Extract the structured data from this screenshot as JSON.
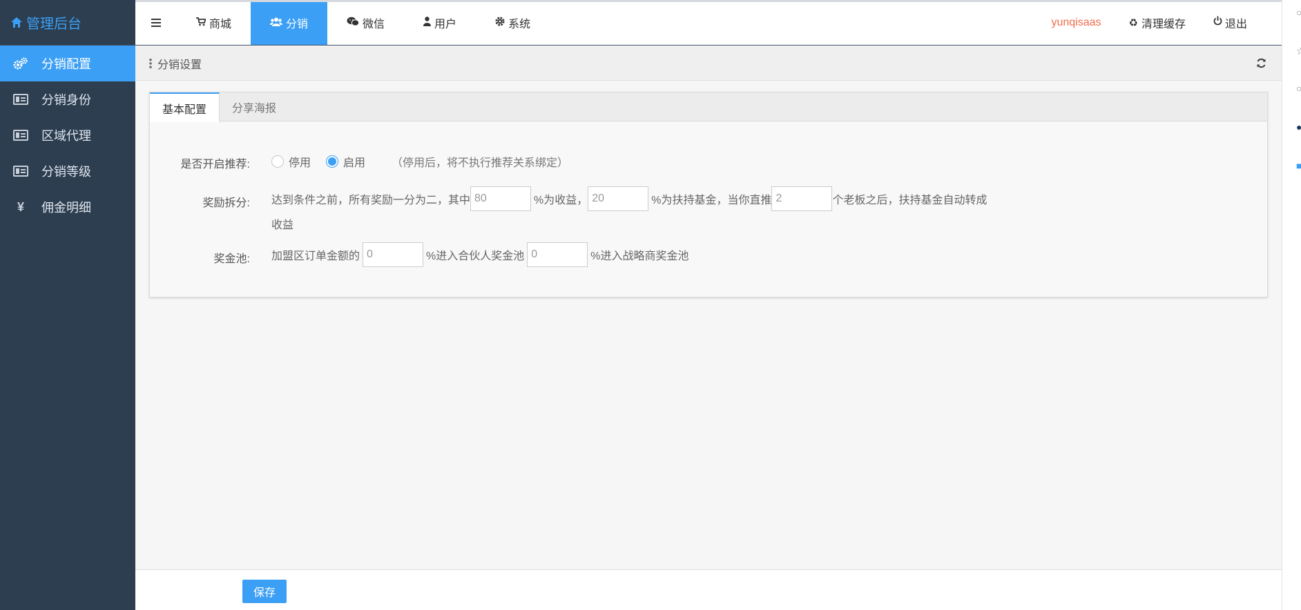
{
  "app": {
    "title": "管理后台"
  },
  "sidebar": {
    "items": [
      {
        "label": "分销配置",
        "active": true
      },
      {
        "label": "分销身份"
      },
      {
        "label": "区域代理"
      },
      {
        "label": "分销等级"
      },
      {
        "label": "佣金明细",
        "icon_text": "¥"
      }
    ]
  },
  "topnav": {
    "items": [
      {
        "label": "商城"
      },
      {
        "label": "分销",
        "active": true
      },
      {
        "label": "微信"
      },
      {
        "label": "用户"
      },
      {
        "label": "系统"
      }
    ],
    "username": "yunqisaas",
    "clear_cache": "清理缓存",
    "logout": "退出"
  },
  "page": {
    "breadcrumb": "分销设置"
  },
  "tabs": [
    {
      "label": "基本配置",
      "active": true
    },
    {
      "label": "分享海报"
    }
  ],
  "form": {
    "recommend": {
      "label": "是否开启推荐:",
      "options": [
        "停用",
        "启用"
      ],
      "selected": "启用",
      "hint": "（停用后，将不执行推荐关系绑定）"
    },
    "reward_split": {
      "label": "奖励拆分:",
      "text1": "达到条件之前，所有奖励一分为二，其中",
      "value1": "80",
      "text2": "%为收益，",
      "value2": "20",
      "text3": "%为扶持基金，当你直推",
      "value3": "2",
      "text4": "个老板之后，扶持基金自动转成",
      "text5": "收益"
    },
    "bonus_pool": {
      "label": "奖金池:",
      "text1": "加盟区订单金额的",
      "value1": "0",
      "text2": "%进入合伙人奖金池",
      "value2": "0",
      "text3": "%进入战略商奖金池"
    }
  },
  "footer": {
    "save_label": "保存"
  },
  "colors": {
    "accent": "#3b9ff5",
    "sidebar_bg": "#2d3e50",
    "username": "#f06b4a"
  }
}
